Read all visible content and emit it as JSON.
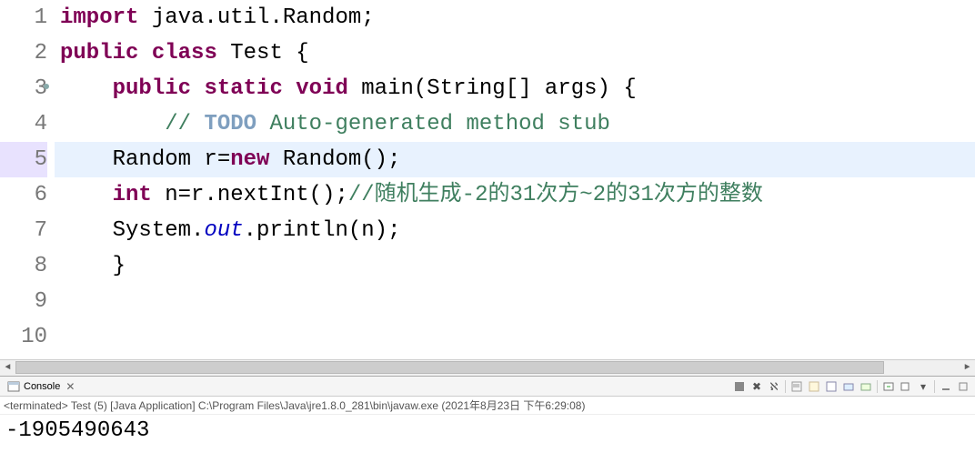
{
  "code": {
    "lines": [
      {
        "n": "1",
        "highlight": false,
        "marker": false,
        "tokens": [
          {
            "t": "import",
            "c": "kw"
          },
          {
            "t": " java.util.Random;"
          }
        ]
      },
      {
        "n": "2",
        "highlight": false,
        "marker": false,
        "tokens": [
          {
            "t": "public",
            "c": "kw"
          },
          {
            "t": " "
          },
          {
            "t": "class",
            "c": "kw"
          },
          {
            "t": " Test {"
          }
        ]
      },
      {
        "n": "3",
        "highlight": false,
        "marker": true,
        "tokens": [
          {
            "t": "    "
          },
          {
            "t": "public",
            "c": "kw"
          },
          {
            "t": " "
          },
          {
            "t": "static",
            "c": "kw"
          },
          {
            "t": " "
          },
          {
            "t": "void",
            "c": "kw"
          },
          {
            "t": " main(String[] args) {"
          }
        ]
      },
      {
        "n": "4",
        "highlight": false,
        "marker": false,
        "tokens": [
          {
            "t": "        "
          },
          {
            "t": "// ",
            "c": "cm"
          },
          {
            "t": "TODO",
            "c": "todo"
          },
          {
            "t": " Auto-generated method stub",
            "c": "cm"
          }
        ]
      },
      {
        "n": "5",
        "highlight": true,
        "marker": false,
        "tokens": [
          {
            "t": "    Random r="
          },
          {
            "t": "new",
            "c": "kw"
          },
          {
            "t": " Random();"
          }
        ]
      },
      {
        "n": "6",
        "highlight": false,
        "marker": false,
        "tokens": [
          {
            "t": "    "
          },
          {
            "t": "int",
            "c": "kw"
          },
          {
            "t": " n=r.nextInt();"
          },
          {
            "t": "//随机生成-2的31次方~2的31次方的整数",
            "c": "cm"
          }
        ]
      },
      {
        "n": "7",
        "highlight": false,
        "marker": false,
        "tokens": [
          {
            "t": "    System."
          },
          {
            "t": "out",
            "c": "fld"
          },
          {
            "t": ".println(n);"
          }
        ]
      },
      {
        "n": "8",
        "highlight": false,
        "marker": false,
        "tokens": [
          {
            "t": "    }"
          }
        ]
      },
      {
        "n": "9",
        "highlight": false,
        "marker": false,
        "tokens": []
      },
      {
        "n": "10",
        "highlight": false,
        "marker": false,
        "tokens": []
      }
    ]
  },
  "console": {
    "tab_label": "Console",
    "status": "<terminated> Test (5) [Java Application] C:\\Program Files\\Java\\jre1.8.0_281\\bin\\javaw.exe (2021年8月23日 下午6:29:08)",
    "output": "-1905490643"
  }
}
